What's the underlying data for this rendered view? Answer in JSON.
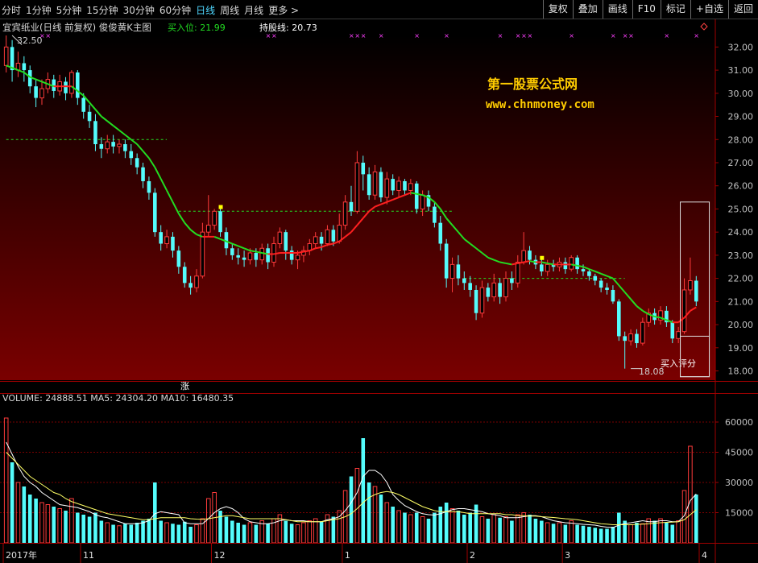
{
  "toolbar": {
    "periods": [
      "分时",
      "1分钟",
      "5分钟",
      "15分钟",
      "30分钟",
      "60分钟",
      "日线",
      "周线",
      "月线",
      "更多 >"
    ],
    "active_period": "日线",
    "buttons": [
      "复权",
      "叠加",
      "画线",
      "F10",
      "标记",
      "+自选",
      "返回"
    ]
  },
  "main_panel": {
    "stock_title": "宜宾纸业(日线 前复权) 俊俊黄K主图",
    "buy_label": "买入位: 21.99",
    "hold_label": "持股线: 20.73",
    "watermark_title": "第一股票公式网",
    "watermark_url": "www.chnmoney.com",
    "high_marker": "32.50",
    "low_marker": "18.08",
    "box_label": "买入评分",
    "rise_label": "涨"
  },
  "volume_panel": {
    "label": "VOLUME: 24888.51  MA5: 24304.20  MA10: 16480.35"
  },
  "x_axis": {
    "labels": [
      "2017年",
      "11",
      "12",
      "1",
      "2",
      "3",
      "4"
    ]
  },
  "chart_data": {
    "type": "candlestick",
    "price_axis": {
      "ylim": [
        17.6,
        32.5
      ],
      "ticks": [
        32.0,
        31.0,
        30.0,
        29.0,
        28.0,
        27.0,
        26.0,
        25.0,
        24.0,
        23.0,
        22.0,
        21.0,
        20.0,
        19.0,
        18.0
      ]
    },
    "volume_axis": {
      "ylim": [
        0,
        68000
      ],
      "ticks": [
        60000,
        45000,
        30000,
        15000
      ]
    },
    "candles": [
      [
        31.2,
        32.0,
        32.5,
        30.9
      ],
      [
        32.0,
        31.0,
        32.3,
        30.5
      ],
      [
        31.0,
        31.3,
        31.8,
        30.7
      ],
      [
        31.3,
        31.0,
        31.6,
        30.5
      ],
      [
        31.0,
        30.3,
        31.2,
        30.0
      ],
      [
        30.3,
        29.8,
        30.6,
        29.4
      ],
      [
        29.8,
        30.2,
        30.6,
        29.5
      ],
      [
        30.2,
        30.6,
        30.9,
        30.0
      ],
      [
        30.6,
        30.1,
        30.8,
        29.8
      ],
      [
        30.1,
        30.5,
        30.8,
        29.9
      ],
      [
        30.5,
        30.0,
        30.7,
        29.7
      ],
      [
        30.0,
        30.9,
        31.0,
        29.8
      ],
      [
        30.9,
        29.8,
        31.0,
        29.5
      ],
      [
        29.8,
        29.2,
        30.0,
        28.9
      ],
      [
        29.2,
        28.8,
        29.5,
        28.5
      ],
      [
        28.8,
        27.8,
        29.1,
        27.5
      ],
      [
        27.8,
        27.6,
        28.1,
        27.2
      ],
      [
        27.6,
        27.9,
        28.2,
        27.4
      ],
      [
        27.9,
        27.7,
        28.2,
        27.4
      ],
      [
        27.7,
        27.8,
        28.0,
        27.4
      ],
      [
        27.8,
        27.5,
        28.0,
        27.2
      ],
      [
        27.5,
        27.2,
        27.8,
        26.9
      ],
      [
        27.2,
        26.8,
        27.4,
        26.5
      ],
      [
        26.8,
        26.2,
        27.0,
        25.9
      ],
      [
        26.2,
        25.7,
        26.4,
        25.4
      ],
      [
        25.7,
        24.0,
        25.9,
        23.8
      ],
      [
        24.0,
        23.5,
        24.3,
        23.2
      ],
      [
        23.5,
        23.8,
        24.1,
        23.3
      ],
      [
        23.8,
        23.2,
        24.0,
        22.9
      ],
      [
        23.2,
        22.5,
        23.4,
        22.2
      ],
      [
        22.5,
        21.8,
        22.7,
        21.6
      ],
      [
        21.8,
        21.6,
        22.1,
        21.3
      ],
      [
        21.6,
        22.1,
        22.4,
        21.4
      ],
      [
        22.1,
        24.0,
        24.4,
        22.0
      ],
      [
        24.0,
        24.3,
        25.6,
        23.8
      ],
      [
        24.3,
        24.9,
        25.0,
        24.1
      ],
      [
        24.9,
        24.0,
        25.1,
        23.8
      ],
      [
        24.0,
        23.3,
        24.2,
        23.0
      ],
      [
        23.3,
        23.0,
        23.5,
        22.8
      ],
      [
        23.0,
        22.9,
        23.3,
        22.6
      ],
      [
        22.9,
        22.8,
        23.2,
        22.5
      ],
      [
        22.8,
        23.1,
        23.3,
        22.6
      ],
      [
        23.1,
        22.8,
        23.3,
        22.5
      ],
      [
        22.8,
        23.3,
        23.5,
        22.6
      ],
      [
        23.3,
        22.7,
        23.5,
        22.4
      ],
      [
        22.7,
        23.5,
        23.8,
        22.5
      ],
      [
        23.5,
        24.0,
        24.2,
        23.3
      ],
      [
        24.0,
        23.2,
        24.1,
        22.8
      ],
      [
        23.2,
        22.8,
        23.4,
        22.6
      ],
      [
        22.8,
        23.0,
        23.2,
        22.4
      ],
      [
        23.0,
        23.2,
        23.4,
        22.7
      ],
      [
        23.2,
        23.5,
        23.7,
        23.0
      ],
      [
        23.5,
        23.8,
        24.0,
        23.3
      ],
      [
        23.8,
        23.5,
        24.0,
        23.2
      ],
      [
        23.5,
        24.1,
        24.3,
        23.4
      ],
      [
        24.1,
        23.6,
        24.3,
        23.4
      ],
      [
        23.6,
        24.3,
        24.8,
        23.5
      ],
      [
        24.3,
        25.3,
        25.6,
        24.1
      ],
      [
        25.3,
        24.9,
        26.0,
        24.7
      ],
      [
        24.9,
        27.0,
        27.5,
        24.8
      ],
      [
        27.0,
        26.5,
        27.3,
        25.8
      ],
      [
        26.5,
        25.6,
        26.8,
        25.4
      ],
      [
        25.6,
        26.6,
        26.9,
        25.4
      ],
      [
        26.6,
        25.5,
        26.8,
        25.3
      ],
      [
        25.5,
        26.3,
        26.6,
        25.2
      ],
      [
        26.3,
        25.8,
        26.5,
        25.6
      ],
      [
        25.8,
        26.2,
        26.4,
        25.5
      ],
      [
        26.2,
        25.8,
        26.3,
        25.6
      ],
      [
        25.8,
        26.1,
        26.3,
        25.6
      ],
      [
        26.1,
        25.0,
        26.2,
        24.8
      ],
      [
        25.0,
        25.6,
        25.8,
        24.7
      ],
      [
        25.6,
        25.1,
        25.8,
        24.9
      ],
      [
        25.1,
        24.4,
        25.3,
        24.2
      ],
      [
        24.4,
        23.5,
        24.7,
        23.2
      ],
      [
        23.5,
        22.0,
        23.7,
        21.6
      ],
      [
        22.0,
        22.6,
        22.9,
        21.4
      ],
      [
        22.6,
        22.0,
        23.0,
        21.7
      ],
      [
        22.0,
        21.8,
        22.3,
        21.5
      ],
      [
        21.8,
        21.5,
        22.1,
        21.2
      ],
      [
        21.5,
        20.5,
        21.7,
        20.2
      ],
      [
        20.5,
        21.6,
        21.9,
        20.3
      ],
      [
        21.6,
        21.2,
        21.8,
        21.0
      ],
      [
        21.2,
        21.8,
        22.2,
        21.0
      ],
      [
        21.8,
        21.2,
        22.0,
        20.9
      ],
      [
        21.2,
        22.0,
        22.3,
        21.0
      ],
      [
        22.0,
        21.8,
        22.3,
        21.5
      ],
      [
        21.8,
        22.7,
        23.0,
        21.6
      ],
      [
        22.7,
        23.2,
        24.0,
        22.6
      ],
      [
        23.2,
        22.8,
        23.4,
        22.6
      ],
      [
        22.8,
        22.6,
        23.0,
        22.4
      ],
      [
        22.6,
        22.3,
        22.9,
        22.1
      ],
      [
        22.3,
        22.6,
        22.8,
        22.1
      ],
      [
        22.6,
        22.5,
        22.8,
        22.3
      ],
      [
        22.5,
        22.7,
        22.9,
        22.3
      ],
      [
        22.7,
        22.4,
        22.9,
        22.2
      ],
      [
        22.4,
        22.9,
        23.0,
        22.3
      ],
      [
        22.9,
        22.4,
        23.0,
        22.2
      ],
      [
        22.4,
        22.3,
        22.6,
        22.1
      ],
      [
        22.3,
        22.1,
        22.4,
        21.9
      ],
      [
        22.1,
        21.9,
        22.2,
        21.7
      ],
      [
        21.9,
        21.6,
        22.0,
        21.4
      ],
      [
        21.6,
        21.5,
        21.8,
        21.3
      ],
      [
        21.5,
        21.0,
        21.7,
        20.9
      ],
      [
        21.0,
        19.5,
        21.1,
        19.3
      ],
      [
        19.5,
        19.3,
        19.7,
        18.1
      ],
      [
        19.3,
        19.6,
        19.8,
        19.1
      ],
      [
        19.6,
        19.2,
        19.8,
        19.0
      ],
      [
        19.2,
        20.1,
        20.3,
        19.1
      ],
      [
        20.1,
        20.5,
        20.7,
        19.9
      ],
      [
        20.5,
        20.2,
        20.7,
        20.0
      ],
      [
        20.2,
        20.6,
        20.8,
        20.0
      ],
      [
        20.6,
        20.1,
        20.8,
        19.9
      ],
      [
        20.1,
        19.4,
        20.2,
        19.2
      ],
      [
        19.4,
        19.7,
        19.9,
        19.2
      ],
      [
        19.7,
        21.5,
        22.0,
        19.6
      ],
      [
        21.5,
        21.9,
        22.9,
        21.3
      ],
      [
        21.9,
        21.0,
        22.1,
        20.8
      ]
    ],
    "volumes": [
      62000,
      40000,
      30000,
      28000,
      24000,
      22000,
      20000,
      19000,
      18000,
      17000,
      16000,
      22000,
      15000,
      14000,
      13000,
      15000,
      11000,
      10000,
      9000,
      8500,
      9500,
      9000,
      10000,
      11000,
      12000,
      30000,
      11000,
      10000,
      9500,
      9000,
      10500,
      8000,
      9000,
      12000,
      22000,
      25000,
      16000,
      13000,
      11000,
      10000,
      9000,
      10000,
      9000,
      11000,
      9500,
      12000,
      14000,
      11000,
      9500,
      9000,
      10000,
      11000,
      12000,
      10500,
      14000,
      13000,
      16000,
      26000,
      33000,
      37000,
      52000,
      30000,
      28000,
      24000,
      20000,
      18000,
      16000,
      15000,
      14000,
      15000,
      13000,
      12000,
      15000,
      18000,
      20000,
      17000,
      16000,
      14000,
      15000,
      19000,
      13000,
      12000,
      14000,
      12500,
      13000,
      11000,
      14000,
      15000,
      14000,
      12000,
      11000,
      10000,
      9500,
      10000,
      9000,
      11000,
      9000,
      8500,
      8000,
      7500,
      7000,
      7000,
      8000,
      15000,
      11000,
      9000,
      10000,
      9500,
      12000,
      11000,
      12000,
      10000,
      9000,
      11000,
      26000,
      48000,
      24000
    ],
    "ma_line": [
      31.2,
      31.1,
      31.0,
      30.9,
      30.7,
      30.6,
      30.5,
      30.4,
      30.3,
      30.3,
      30.3,
      30.3,
      30.1,
      29.9,
      29.6,
      29.3,
      29.0,
      28.8,
      28.6,
      28.4,
      28.2,
      28.0,
      27.8,
      27.5,
      27.2,
      26.8,
      26.3,
      25.8,
      25.3,
      24.8,
      24.4,
      24.1,
      23.9,
      23.8,
      23.8,
      23.8,
      23.7,
      23.6,
      23.5,
      23.4,
      23.3,
      23.2,
      23.15,
      23.1,
      23.05,
      23.05,
      23.1,
      23.1,
      23.1,
      23.1,
      23.15,
      23.2,
      23.3,
      23.35,
      23.45,
      23.5,
      23.6,
      23.8,
      24.0,
      24.3,
      24.6,
      24.9,
      25.1,
      25.2,
      25.3,
      25.4,
      25.5,
      25.6,
      25.7,
      25.65,
      25.6,
      25.5,
      25.3,
      25.0,
      24.6,
      24.3,
      24.0,
      23.7,
      23.5,
      23.3,
      23.1,
      22.9,
      22.8,
      22.7,
      22.65,
      22.6,
      22.65,
      22.7,
      22.75,
      22.7,
      22.7,
      22.65,
      22.6,
      22.6,
      22.6,
      22.6,
      22.55,
      22.5,
      22.4,
      22.3,
      22.2,
      22.1,
      22.0,
      21.7,
      21.4,
      21.1,
      20.8,
      20.6,
      20.45,
      20.35,
      20.3,
      20.2,
      20.1,
      20.1,
      20.3,
      20.6,
      20.75
    ],
    "buy_line_price": 21.99,
    "levels": [
      {
        "price": 28.0,
        "from": 0,
        "to": 27
      },
      {
        "price": 24.9,
        "from": 29,
        "to": 75
      },
      {
        "price": 22.0,
        "from": 77,
        "to": 104
      }
    ],
    "vol_ma5": [
      50000,
      44000,
      38000,
      33000,
      30000,
      28000,
      25000,
      23000,
      21000,
      19000,
      18500,
      18000,
      17500,
      16500,
      15500,
      14000,
      13000,
      12500,
      11500,
      10500,
      9500,
      9500,
      9500,
      10000,
      11000,
      14500,
      15500,
      15000,
      14500,
      14000,
      10000,
      9500,
      9500,
      9500,
      12000,
      15000,
      17000,
      18000,
      17000,
      15000,
      12000,
      10500,
      10000,
      9500,
      9500,
      10000,
      11000,
      11500,
      11000,
      11000,
      11000,
      10500,
      10500,
      10500,
      11500,
      12000,
      13000,
      16000,
      20000,
      25000,
      33000,
      36000,
      36000,
      34000,
      30000,
      24000,
      21000,
      18500,
      17000,
      15500,
      14500,
      14000,
      13800,
      14500,
      15500,
      16500,
      17000,
      17000,
      16500,
      16000,
      15500,
      14500,
      14000,
      13500,
      12500,
      12500,
      12500,
      13000,
      13500,
      13500,
      13000,
      12000,
      11000,
      10500,
      10000,
      9800,
      9500,
      9200,
      9000,
      8800,
      8200,
      7800,
      7600,
      8800,
      9600,
      10000,
      10500,
      11000,
      10500,
      10500,
      11000,
      11000,
      10500,
      10500,
      13500,
      21000,
      24304
    ],
    "vol_ma10": [
      45000,
      42000,
      39000,
      36000,
      33000,
      31000,
      29000,
      27000,
      25000,
      24000,
      22000,
      20500,
      19500,
      18500,
      17500,
      16500,
      15500,
      14500,
      14000,
      13500,
      13000,
      12500,
      12000,
      11500,
      11500,
      12000,
      12500,
      12500,
      12500,
      12500,
      12500,
      12000,
      11800,
      11700,
      12000,
      12500,
      13000,
      13500,
      13500,
      13000,
      12500,
      12000,
      12000,
      12000,
      12000,
      12000,
      12000,
      11500,
      11000,
      10500,
      10500,
      10500,
      10500,
      10500,
      11000,
      11500,
      12000,
      13000,
      14500,
      17000,
      20000,
      22500,
      24000,
      25000,
      25500,
      25000,
      24000,
      22500,
      21000,
      19500,
      18000,
      17000,
      16000,
      15500,
      15500,
      15500,
      15500,
      15000,
      14500,
      14500,
      14500,
      14500,
      14500,
      14500,
      14000,
      14000,
      13500,
      13500,
      13300,
      13300,
      13000,
      12800,
      12600,
      12300,
      12000,
      11800,
      11500,
      11000,
      10500,
      10000,
      9500,
      9300,
      9000,
      9000,
      9000,
      9000,
      9200,
      9300,
      9500,
      9800,
      10000,
      10200,
      10300,
      10500,
      11500,
      14000,
      16480
    ],
    "date_breaks": [
      {
        "index": 0,
        "label": "2017年"
      },
      {
        "index": 13,
        "label": "11"
      },
      {
        "index": 35,
        "label": "12"
      },
      {
        "index": 57,
        "label": "1"
      },
      {
        "index": 78,
        "label": "2"
      },
      {
        "index": 94,
        "label": "3"
      },
      {
        "index": 117,
        "label": "4"
      }
    ],
    "colors": {
      "up": "#ff3b3b",
      "down": "#54fcfc",
      "bg_top": "#000000",
      "bg_bottom": "#7a0000",
      "ma_green": "#22dd22",
      "ma_red": "#ff2020",
      "grid": "#8b0000",
      "axis_text": "#c0c0c0",
      "yellow": "#ffff00",
      "magenta": "#ff40ff"
    }
  }
}
